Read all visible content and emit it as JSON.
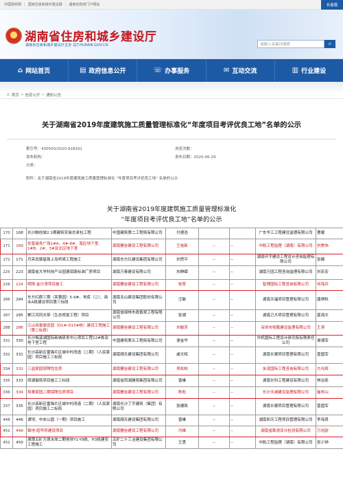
{
  "topbar": {
    "links": [
      "中国政府网",
      "国家住房和城乡建设部",
      "湖南省政府门户网站"
    ],
    "access_button": "长者版"
  },
  "header": {
    "site_title": "湖南省住房和城乡建设厅",
    "site_subtitle": "湖南省住房和城乡建设厅主办  ZJT.HUNAN.GOV.CN",
    "search_placeholder": "请输入关键词搜索",
    "search_icon": "magnifier-icon"
  },
  "nav": {
    "items": [
      {
        "label": "网站首页",
        "icon": "home-icon"
      },
      {
        "label": "政府信息公开",
        "icon": "document-icon"
      },
      {
        "label": "办事服务",
        "icon": "service-icon"
      },
      {
        "label": "互动交流",
        "icon": "chat-icon"
      },
      {
        "label": "行业建设",
        "icon": "building-icon"
      }
    ]
  },
  "breadcrumb": [
    "首页",
    "信息公开",
    "通知公告"
  ],
  "article": {
    "title": "关于湖南省2019年度建筑施工质量管理标准化“年度项目考评优良工地”名单的公示",
    "index_label": "索引号：430500/2020-918291",
    "browse_label": "浏览次数：",
    "publisher_label": "发布机构：",
    "date_label": "发布日期：2020-06-29",
    "category_label": "分类：",
    "attachment_label": "附件：",
    "attachment_value": "关于湖南省2019年度建筑施工质量管理标准化 “年度项目考评优良工地” 名单的公示",
    "doc_title_line1": "关于湖南省2019年度建筑施工质量管理标准化",
    "doc_title_line2": "“年度项目考评优良工地”名单的公示"
  },
  "table": {
    "rows": [
      {
        "idx": "170",
        "no": "168",
        "project": "长沙融创城2.1期建筑安装总承包工程",
        "builder": "中国建筑第二工程局有限公司",
        "manager": "付德浩",
        "c5": "",
        "c6": "",
        "supervisor": "广东华工工程建设监理有限公司",
        "chief": "曹耀",
        "hl": false
      },
      {
        "idx": "171",
        "no": "169",
        "project": "优普商务广场1#A、4#-8#、南区地下室、1#B、2#、3#及北区地下室",
        "builder": "湖南麓谷建设工程有限公司",
        "manager": "王裕新",
        "c5": "--",
        "c6": "--",
        "supervisor": "中航工程监理（湖南）有限公司",
        "chief": "刘崇伟",
        "hl": true
      },
      {
        "idx": "172",
        "no": "171",
        "project": "月亮岛银星路上岛桥梁工程施工",
        "builder": "湖南东方红建设集团有限公司",
        "manager": "刘思平",
        "c5": "--",
        "c6": "--",
        "supervisor": "湖南环宇建设工程设计咨询监理有限公司",
        "chief": "张健",
        "hl": false
      },
      {
        "idx": "225",
        "no": "223",
        "project": "湖南省大学科技产业园德润路标准厂房项目",
        "builder": "湖南万泰建设有限公司",
        "manager": "刘峥嵘",
        "c5": "--",
        "c6": "--",
        "supervisor": "湖南万园工程咨询监理有限公司",
        "chief": "刘宏宏",
        "hl": false
      },
      {
        "idx": "226",
        "no": "224",
        "project": "明珠·金沙湾项目施工",
        "builder": "湖南麓谷建设工程有限公司",
        "manager": "桂赞",
        "c5": "--",
        "c6": "--",
        "supervisor": "智博国际工程咨询有限公司",
        "chief": "何海兵",
        "hl": true
      },
      {
        "idx": "286",
        "no": "284",
        "project": "东方红郡三期（芙蓉园）5-9#、地库（二）、商业A段建设项目第三标段",
        "builder": "湖南北山建设集团股份有限公司",
        "manager": "汪敏",
        "c5": "--",
        "c6": "--",
        "supervisor": "湖南天福项目管理有限公司",
        "chief": "唐祺秋",
        "hl": false
      },
      {
        "idx": "287",
        "no": "285",
        "project": "郴江河风光带（生态修复工程）项目",
        "builder": "湖南省绿林市政景观工程有限公司",
        "manager": "张湖",
        "c5": "--",
        "c6": "--",
        "supervisor": "湖南己大项目管理有限公司",
        "chief": "莫海文",
        "hl": false
      },
      {
        "idx": "288",
        "no": "286",
        "project": "江山帝景御览园（D1#-D15#栋）建设工程施工（第二标段）",
        "builder": "湖南麓谷建设工程有限公司",
        "manager": "刘敏芳",
        "c5": "--",
        "c6": "--",
        "supervisor": "深圳市粤鹏建设监理有限公司",
        "chief": "王涛",
        "hl": true
      },
      {
        "idx": "331",
        "no": "330",
        "project": "长沙梅溪湖国际新城研发中心项目工程12#栋及地下室工程",
        "builder": "中国建筑第五工程局有限公司",
        "manager": "谢金华",
        "c5": "--",
        "c6": "--",
        "supervisor": "中机国际工程设计研究院有限责任公司",
        "chief": "谢湘军",
        "hl": false
      },
      {
        "idx": "332",
        "no": "331",
        "project": "长沙高新区雷锋片区城中村改造（二期）（人民家园）项目施工三标段",
        "builder": "湖南顺天建设集团有限公司",
        "manager": "戚文辉",
        "c5": "--",
        "c6": "--",
        "supervisor": "湖南长顺项目管理有限公司",
        "chief": "曾国军",
        "hl": false
      },
      {
        "idx": "334",
        "no": "332",
        "project": "三益家园保障性住房",
        "builder": "湖南麓谷建设工程有限公司",
        "manager": "吴松柏",
        "c5": "--",
        "c6": "--",
        "supervisor": "友谊国际工程咨询有限公司",
        "chief": "方光辉",
        "hl": true
      },
      {
        "idx": "335",
        "no": "333",
        "project": "西湖御苑项目施工三标段",
        "builder": "湖南省西湖建筑集团有限公司",
        "manager": "曾峰",
        "c5": "--",
        "c6": "--",
        "supervisor": "湖南长科工程建设有限公司",
        "chief": "林治炼",
        "hl": false
      },
      {
        "idx": "336",
        "no": "334",
        "project": "和泰家园二期保障住房项目",
        "builder": "湖南麓谷建设工程有限公司",
        "manager": "陈彪",
        "c5": "--",
        "c6": "--",
        "supervisor": "长沙天诚建设监理有限公司",
        "chief": "崔邦山",
        "hl": true
      },
      {
        "idx": "337",
        "no": "335",
        "project": "长沙高新区雷锋片区城中村改造（二期）（人民家园）项目施工二标段",
        "builder": "湖南长沙丁字建筑（集团）有限公司",
        "manager": "张建政",
        "c5": "--",
        "c6": "--",
        "supervisor": "湖南长顺项目管理有限公司",
        "chief": "曾国军",
        "hl": false
      },
      {
        "idx": "448",
        "no": "446",
        "project": "谭坝、中央公园（一期）项目施工",
        "builder": "湖南顺天建设集团有限公司",
        "manager": "曾峰",
        "c5": "--",
        "c6": "--",
        "supervisor": "湖南和天工程项目管理有限公司",
        "chief": "李海良",
        "hl": false
      },
      {
        "idx": "451",
        "no": "449",
        "project": "致地·昭华府建设项目",
        "builder": "湖南麓谷建设工程有限公司",
        "manager": "冯維",
        "c5": "--",
        "c6": "--",
        "supervisor": "湖南省勘测设计检测有限公司",
        "chief": "万兆欧",
        "hl": true
      },
      {
        "idx": "452",
        "no": "450",
        "project": "湘潭五矿万境水岸二期地块Y1-Y9栋、H3栋建安工程施工",
        "builder": "五矿二十三冶建设集团有限公司",
        "manager": "王勇",
        "c5": "--",
        "c6": "--",
        "supervisor": "中航工程监理（湖南）有限公司",
        "chief": "张少钟",
        "hl": false
      }
    ]
  }
}
